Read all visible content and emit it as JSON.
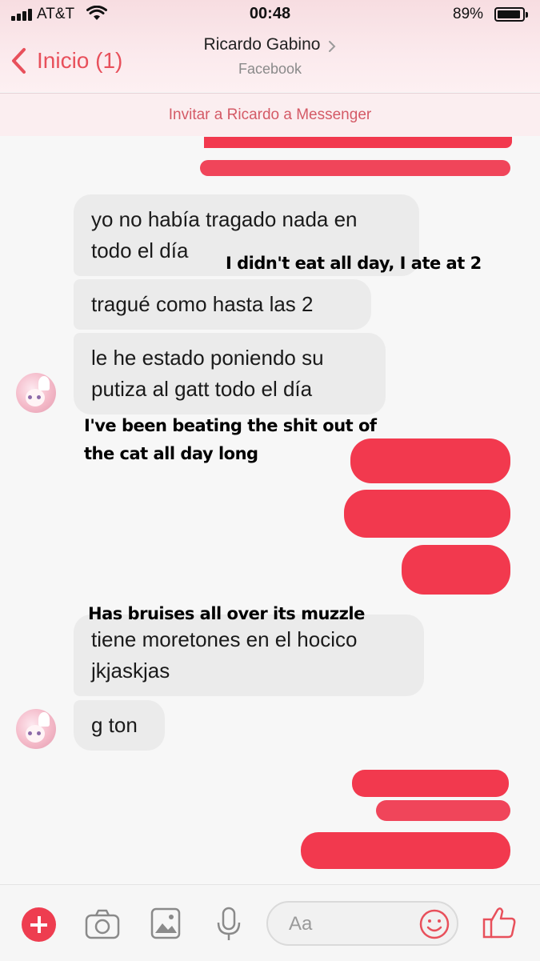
{
  "status_bar": {
    "carrier": "AT&T",
    "time": "00:48",
    "battery_percent": "89%",
    "battery_level": 0.89
  },
  "header": {
    "back_label": "Inicio (1)",
    "contact_name": "Ricardo Gabino",
    "contact_source": "Facebook"
  },
  "invite_banner": "Invitar a Ricardo a Messenger",
  "messages": [
    {
      "sender": "contact",
      "lines": [
        "yo no había tragado nada en",
        "todo el día"
      ]
    },
    {
      "sender": "contact",
      "lines": [
        "tragué como hasta las 2"
      ]
    },
    {
      "sender": "contact",
      "lines": [
        "le he estado poniendo su",
        "putiza al gatt todo el día"
      ]
    },
    {
      "sender": "contact",
      "lines": [
        "tiene moretones en el hocico",
        "jkjaskjas"
      ]
    },
    {
      "sender": "contact",
      "lines": [
        "g ton"
      ]
    }
  ],
  "annotations": [
    "I didn't eat all day, I ate at 2",
    "I've been beating the shit out of",
    "the cat all day long",
    "Has bruises all over its muzzle"
  ],
  "composer": {
    "placeholder": "Aa"
  },
  "colors": {
    "accent": "#e8505b",
    "redaction": "#f2394e",
    "bubble": "#ebebeb"
  },
  "icons": [
    "back-chevron-icon",
    "plus-icon",
    "camera-icon",
    "photo-icon",
    "microphone-icon",
    "emoji-icon",
    "thumbs-up-icon"
  ]
}
